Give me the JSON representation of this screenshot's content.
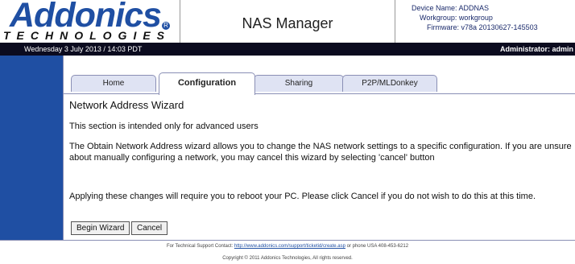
{
  "header": {
    "logo_main": "Addonics",
    "logo_sub": "TECHNOLOGIES",
    "logo_reg": "R",
    "app_title": "NAS Manager",
    "device_name": "Device Name: ADDNAS",
    "workgroup": "Workgroup: workgroup",
    "firmware": "Firmware: v78a 20130627-145503"
  },
  "statusbar": {
    "date": "Wednesday 3 July 2013 / 14:03 PDT",
    "admin": "Administrator: admin"
  },
  "tabs": [
    {
      "label": "Home"
    },
    {
      "label": "Configuration"
    },
    {
      "label": "Sharing"
    },
    {
      "label": "P2P/MLDonkey"
    }
  ],
  "main": {
    "title": "Network Address Wizard",
    "para1": "This section is intended only for advanced users",
    "para2": "The Obtain Network Address wizard allows you to change the NAS network settings to a specific configuration. If you are unsure about manually configuring a network, you may cancel this wizard by selecting 'cancel' button",
    "para3": "Applying these changes will require you to reboot your PC. Please click Cancel if you do not wish to do this at this time.",
    "begin_label": "Begin Wizard",
    "cancel_label": "Cancel"
  },
  "footer": {
    "support_prefix": "For Technical Support Contact: ",
    "support_link": "http://www.addonics.com/support/ticketid/create.asp",
    "support_suffix": " or phone USA 408-453-6212",
    "copyright": "Copyright © 2011 Addonics Technologies, All rights reserved."
  },
  "colors": {
    "brand": "#1f4fa3",
    "statusbar": "#0b0b1f",
    "tab_bg": "#dfe3f3"
  }
}
